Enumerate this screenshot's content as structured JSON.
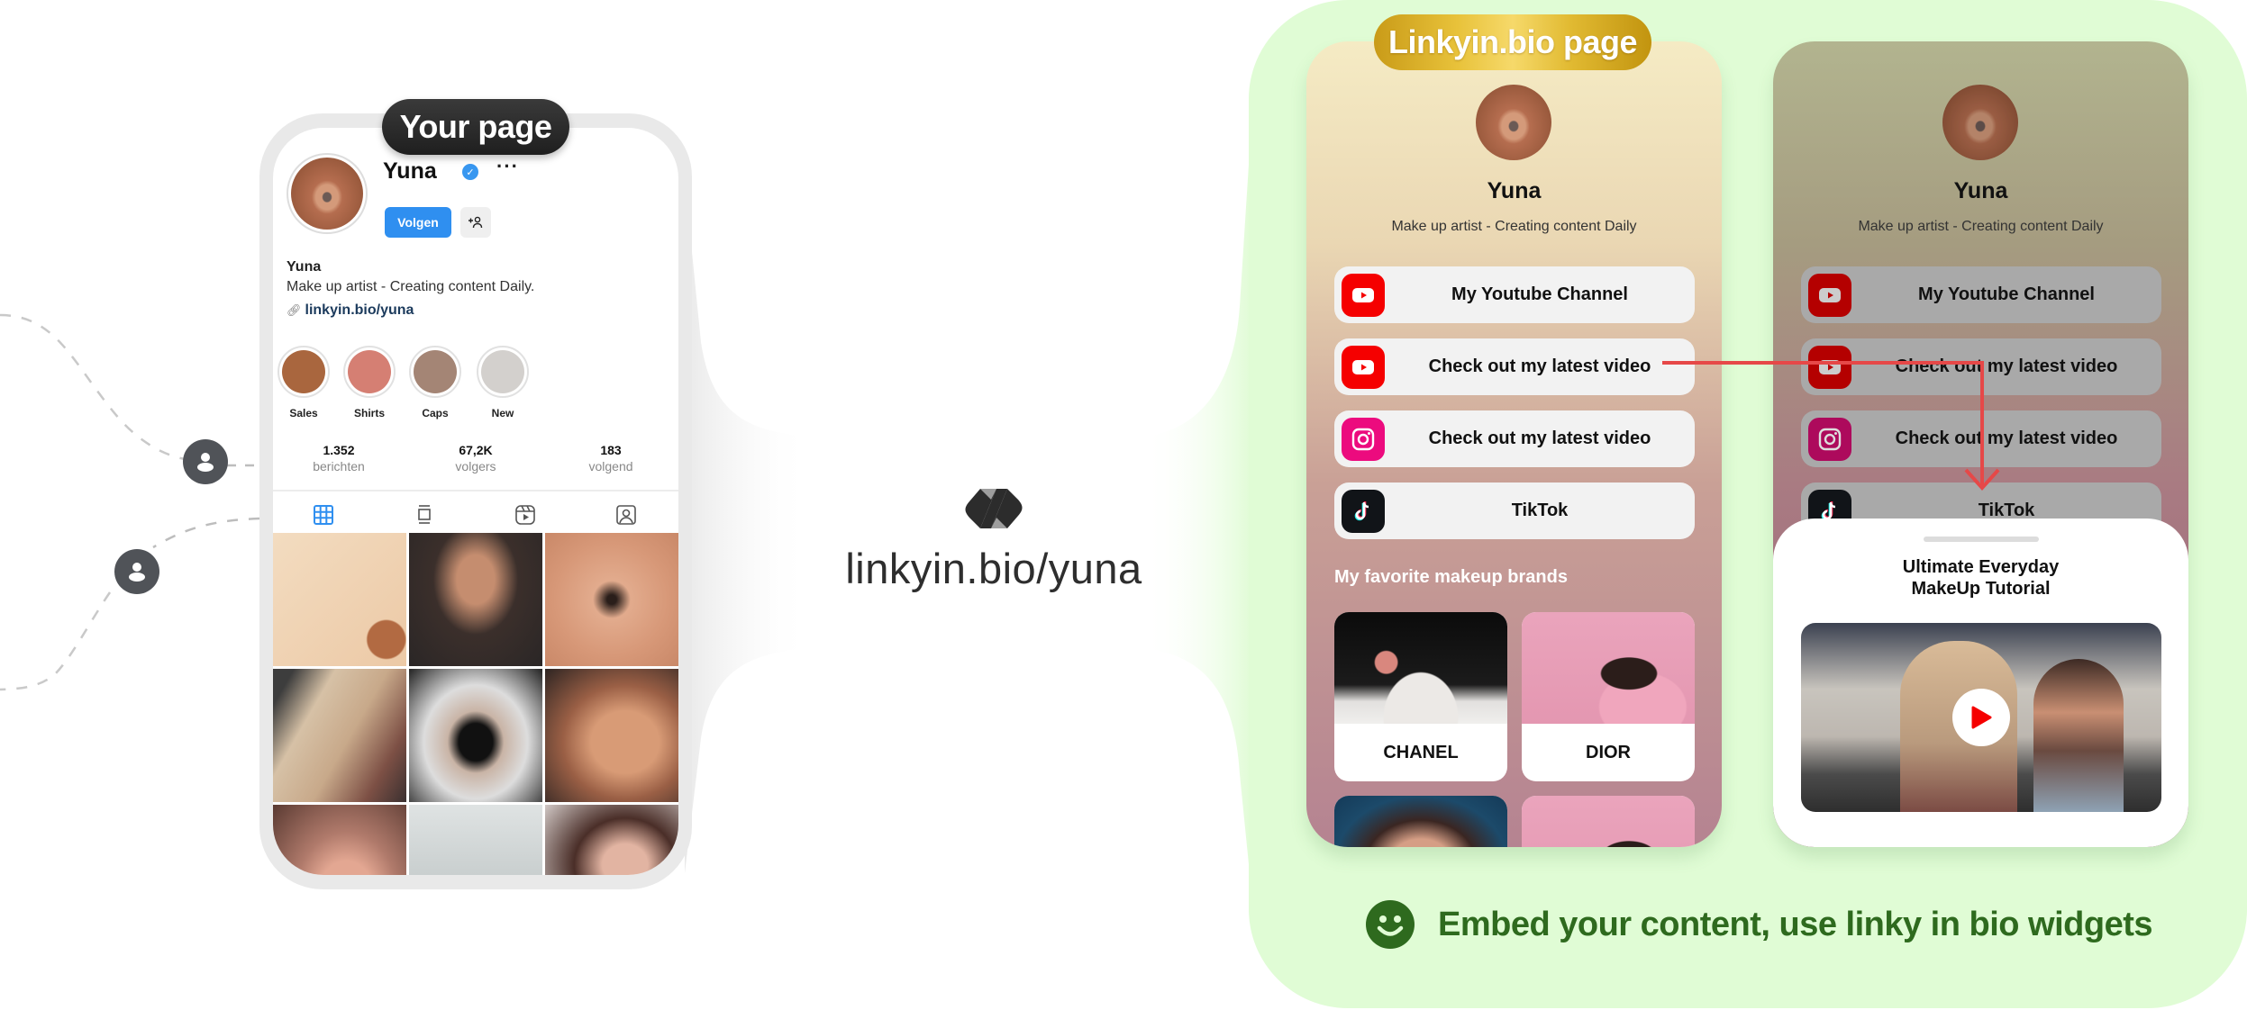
{
  "left": {
    "badge": "Your page",
    "profile": {
      "username": "Yuna",
      "follow_label": "Volgen",
      "add_user_icon": "add-user-icon",
      "more_icon": "more-icon",
      "bio_name": "Yuna",
      "bio_text": "Make up artist - Creating content Daily.",
      "link": "linkyin.bio/yuna"
    },
    "highlights": [
      {
        "label": "Sales",
        "color": "#a9663e"
      },
      {
        "label": "Shirts",
        "color": "#d57f73"
      },
      {
        "label": "Caps",
        "color": "#a48575"
      },
      {
        "label": "New",
        "color": "#d3d0cd"
      }
    ],
    "stats": [
      {
        "value": "1.352",
        "label": "berichten"
      },
      {
        "value": "67,2K",
        "label": "volgers"
      },
      {
        "value": "183",
        "label": "volgend"
      }
    ],
    "tabs": [
      "grid-icon",
      "feed-icon",
      "reels-icon",
      "tagged-icon"
    ],
    "active_tab_color": "#2f8ff0",
    "grid_colors": [
      "#f0d6b8",
      "#4a403c",
      "#d9a184",
      "#b69885",
      "#3c3a38",
      "#b27b5e",
      "#c99488",
      "#d8dcdd",
      "#8a6d63"
    ]
  },
  "center": {
    "url": "linkyin.bio/yuna"
  },
  "right": {
    "badge": "Linkyin.bio page",
    "profile": {
      "name": "Yuna",
      "bio": "Make up artist - Creating content Daily"
    },
    "links": [
      {
        "icon": "youtube-icon",
        "label": "My Youtube Channel"
      },
      {
        "icon": "youtube-icon",
        "label": "Check out my latest video"
      },
      {
        "icon": "instagram-icon",
        "label": "Check out my latest video"
      },
      {
        "icon": "tiktok-icon",
        "label": "TikTok"
      }
    ],
    "section_title": "My favorite makeup brands",
    "brands": [
      {
        "label": "CHANEL"
      },
      {
        "label": "DIOR"
      }
    ],
    "sheet": {
      "title_line1": "Ultimate Everyday",
      "title_line2": "MakeUp Tutorial"
    },
    "footer": "Embed your content, use linky in bio widgets",
    "colors": {
      "panel": "#e0fcd5",
      "footer_text": "#2e6a1e",
      "arrow": "#e64848",
      "youtube": "#f50000",
      "instagram": "#ec0b7e",
      "tiktok": "#111418"
    }
  }
}
